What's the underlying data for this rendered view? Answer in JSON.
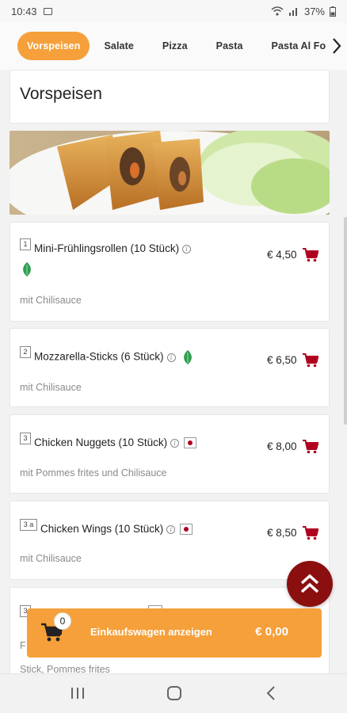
{
  "status_bar": {
    "time": "10:43",
    "battery": "37%"
  },
  "tabs": [
    {
      "label": "Vorspeisen",
      "active": true
    },
    {
      "label": "Salate",
      "active": false
    },
    {
      "label": "Pizza",
      "active": false
    },
    {
      "label": "Pasta",
      "active": false
    },
    {
      "label": "Pasta Al Forno",
      "active": false
    }
  ],
  "section": {
    "title": "Vorspeisen"
  },
  "items": [
    {
      "number": "1",
      "name": "Mini-Frühlingsrollen (10 Stück)",
      "description": "mit Chilisauce",
      "price": "€ 4,50"
    },
    {
      "number": "2",
      "name": "Mozzarella-Sticks (6 Stück)",
      "description": "mit Chilisauce",
      "price": "€ 6,50"
    },
    {
      "number": "3",
      "name": "Chicken Nuggets (10 Stück)",
      "description": "mit Pommes frites und Chilisauce",
      "price": "€ 8,00"
    },
    {
      "number": "3 a",
      "name": "Chicken Wings (10 Stück)",
      "description": "mit Chilisauce",
      "price": "€ 8,50"
    },
    {
      "number": "3",
      "name": "",
      "description_line1": "F",
      "description_line2": "Stick, Pommes frites",
      "price": ""
    }
  ],
  "cart": {
    "count": "0",
    "label": "Einkaufswagen anzeigen",
    "total": "€ 0,00"
  },
  "colors": {
    "accent": "#f5a03a",
    "cart_icon": "#b00020",
    "fab": "#8b0f0f",
    "veg_leaf": "#2e9e4f"
  },
  "icons": {
    "info": "info-icon",
    "cart": "shopping-cart-icon",
    "vegetarian": "leaf-icon",
    "spicy": "spicy-icon",
    "scroll_top": "double-chevron-up-icon",
    "tab_next": "chevron-right-icon"
  }
}
